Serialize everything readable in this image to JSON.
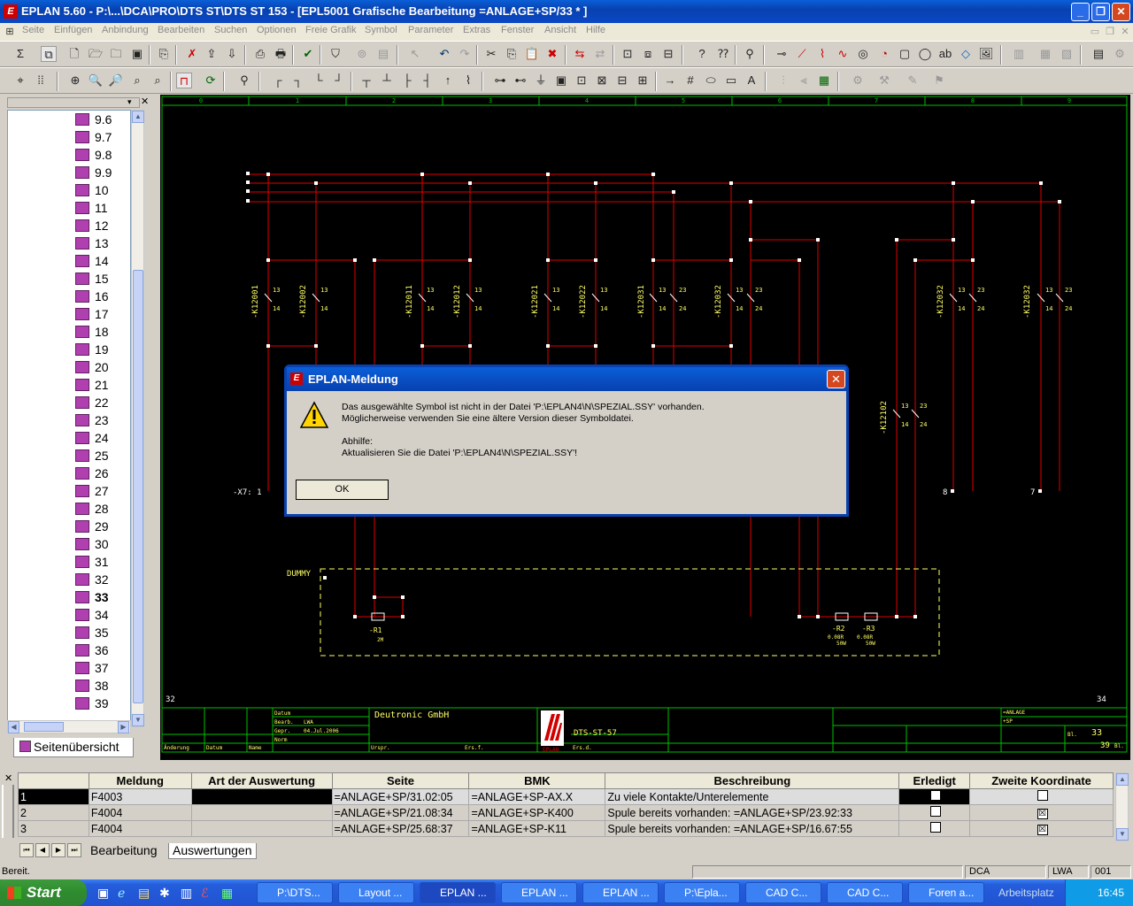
{
  "window": {
    "title": "EPLAN 5.60 - P:\\...\\DCA\\PRO\\DTS ST\\DTS ST 153 - [EPL5001 Grafische Bearbeitung =ANLAGE+SP/33   * ]",
    "icon": "eplan-logo-icon"
  },
  "menu": [
    "Seite",
    "Einfügen",
    "Anbindung",
    "Bearbeiten",
    "Suchen",
    "Optionen",
    "Freie Grafik",
    "Symbol",
    "Parameter",
    "Extras",
    "Fenster",
    "Ansicht",
    "Hilfe"
  ],
  "tree": {
    "items": [
      "9.6",
      "9.7",
      "9.8",
      "9.9",
      "10",
      "11",
      "12",
      "13",
      "14",
      "15",
      "16",
      "17",
      "18",
      "19",
      "20",
      "21",
      "22",
      "23",
      "24",
      "25",
      "26",
      "27",
      "28",
      "29",
      "30",
      "31",
      "32",
      "33",
      "34",
      "35",
      "36",
      "37",
      "38",
      "39"
    ],
    "current": "33",
    "tab_label": "Seitenübersicht"
  },
  "drawing": {
    "columns": [
      "0",
      "1",
      "2",
      "3",
      "4",
      "5",
      "6",
      "7",
      "8",
      "9"
    ],
    "page_left": "32",
    "page_right": "34",
    "terminal_label": "-X7: 1",
    "dummy_label": "DUMMY",
    "terminal_8": "8",
    "terminal_7": "7",
    "contacts": [
      "-K12001",
      "-K12002",
      "-K12011",
      "-K12012",
      "-K12021",
      "-K12022",
      "-K12031",
      "-K12032",
      "-K12032",
      "-K12032",
      "-K12102"
    ],
    "contact_pins": {
      "a": "13",
      "b": "14",
      "c": "23",
      "d": "24"
    },
    "resistors": [
      {
        "name": "-R1",
        "value": "2M",
        "value2": ""
      },
      {
        "name": "-R2",
        "value": "0.08R",
        "value2": "50W"
      },
      {
        "name": "-R3",
        "value": "0.08R",
        "value2": "50W"
      }
    ],
    "titleblock": {
      "datum_label": "Datum",
      "bearb_label": "Bearb.",
      "bearb_value": "LWA",
      "gepr_label": "Gepr.",
      "gepr_value": "04.Jul.2006",
      "norm_label": "Norm",
      "aenderung_label": "Änderung",
      "datum2_label": "Datum",
      "name_label": "Name",
      "urspr_label": "Urspr.",
      "ers_f_label": "Ers.f.",
      "ers_d_label": "Ers.d.",
      "company": "Deutronic GmbH",
      "drawing_no": "DTS-ST-57",
      "logo_text": "EPLAN",
      "anlage": "=ANLAGE",
      "sp": "+SP",
      "bl_label": "Bl.",
      "page": "33",
      "total": "39",
      "total_suffix": "Bl."
    }
  },
  "dialog": {
    "title": "EPLAN-Meldung",
    "line1": "Das ausgewählte Symbol ist nicht in der Datei 'P:\\EPLAN4\\N\\SPEZIAL.SSY' vorhanden.",
    "line2": "Möglicherweise verwenden Sie eine ältere Version dieser Symboldatei.",
    "line3": "Abhilfe:",
    "line4": "Aktualisieren Sie die Datei 'P:\\EPLAN4\\N\\SPEZIAL.SSY'!",
    "ok": "OK"
  },
  "table": {
    "headers": [
      "Meldung",
      "Art der Auswertung",
      "Seite",
      "BMK",
      "Beschreibung",
      "Erledigt",
      "Zweite Koordinate"
    ],
    "rows": [
      {
        "n": "1",
        "meldung": "F4003",
        "art": "",
        "seite": "=ANLAGE+SP/31.02:05",
        "bmk": "=ANLAGE+SP-AX.X",
        "beschreibung": "Zu viele Kontakte/Unterelemente",
        "erledigt": "",
        "zweite": ""
      },
      {
        "n": "2",
        "meldung": "F4004",
        "art": "",
        "seite": "=ANLAGE+SP/21.08:34",
        "bmk": "=ANLAGE+SP-K400",
        "beschreibung": "Spule bereits vorhanden: =ANLAGE+SP/23.92:33",
        "erledigt": "",
        "zweite": "☒"
      },
      {
        "n": "3",
        "meldung": "F4004",
        "art": "",
        "seite": "=ANLAGE+SP/25.68:37",
        "bmk": "=ANLAGE+SP-K11",
        "beschreibung": "Spule bereits vorhanden: =ANLAGE+SP/16.67:55",
        "erledigt": "",
        "zweite": "☒"
      }
    ],
    "tabs": [
      "Bearbeitung",
      "Auswertungen"
    ]
  },
  "status": {
    "text": "Bereit.",
    "user1": "DCA",
    "user2": "LWA",
    "num": "001"
  },
  "taskbar": {
    "start": "Start",
    "buttons": [
      "P:\\DTS...",
      "Layout ...",
      "EPLAN ...",
      "EPLAN ...",
      "EPLAN ...",
      "P:\\Epla...",
      "CAD C...",
      "CAD C...",
      "Foren a..."
    ],
    "workspace": "Arbeitsplatz",
    "time": "16:45"
  }
}
